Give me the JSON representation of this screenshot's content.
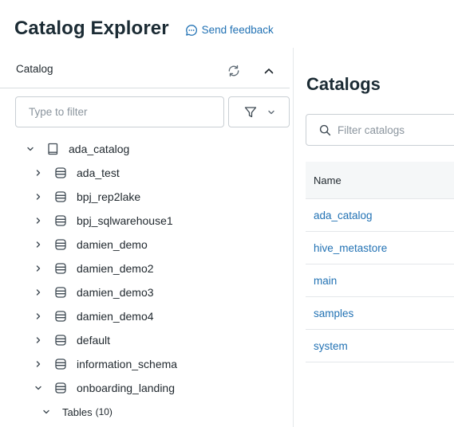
{
  "header": {
    "title": "Catalog Explorer",
    "feedback_label": "Send feedback"
  },
  "sidebar": {
    "label": "Catalog",
    "filter_placeholder": "Type to filter",
    "tree": [
      {
        "label": "ada_catalog",
        "level": 0,
        "expanded": true,
        "icon": "book-icon"
      },
      {
        "label": "ada_test",
        "level": 1,
        "expanded": false,
        "icon": "database-icon"
      },
      {
        "label": "bpj_rep2lake",
        "level": 1,
        "expanded": false,
        "icon": "database-icon"
      },
      {
        "label": "bpj_sqlwarehouse1",
        "level": 1,
        "expanded": false,
        "icon": "database-icon"
      },
      {
        "label": "damien_demo",
        "level": 1,
        "expanded": false,
        "icon": "database-icon"
      },
      {
        "label": "damien_demo2",
        "level": 1,
        "expanded": false,
        "icon": "database-icon"
      },
      {
        "label": "damien_demo3",
        "level": 1,
        "expanded": false,
        "icon": "database-icon"
      },
      {
        "label": "damien_demo4",
        "level": 1,
        "expanded": false,
        "icon": "database-icon"
      },
      {
        "label": "default",
        "level": 1,
        "expanded": false,
        "icon": "database-icon"
      },
      {
        "label": "information_schema",
        "level": 1,
        "expanded": false,
        "icon": "database-icon"
      },
      {
        "label": "onboarding_landing",
        "level": 1,
        "expanded": true,
        "icon": "database-icon"
      },
      {
        "label": "Tables",
        "count": "(10)",
        "level": 2,
        "expanded": true,
        "icon": ""
      }
    ]
  },
  "main": {
    "title": "Catalogs",
    "search_placeholder": "Filter catalogs",
    "table": {
      "column": "Name",
      "rows": [
        "ada_catalog",
        "hive_metastore",
        "main",
        "samples",
        "system"
      ]
    }
  },
  "colors": {
    "link": "#2272b4",
    "text": "#1f272d",
    "border": "#c9cfd4",
    "header_bg": "#f5f7f8"
  }
}
